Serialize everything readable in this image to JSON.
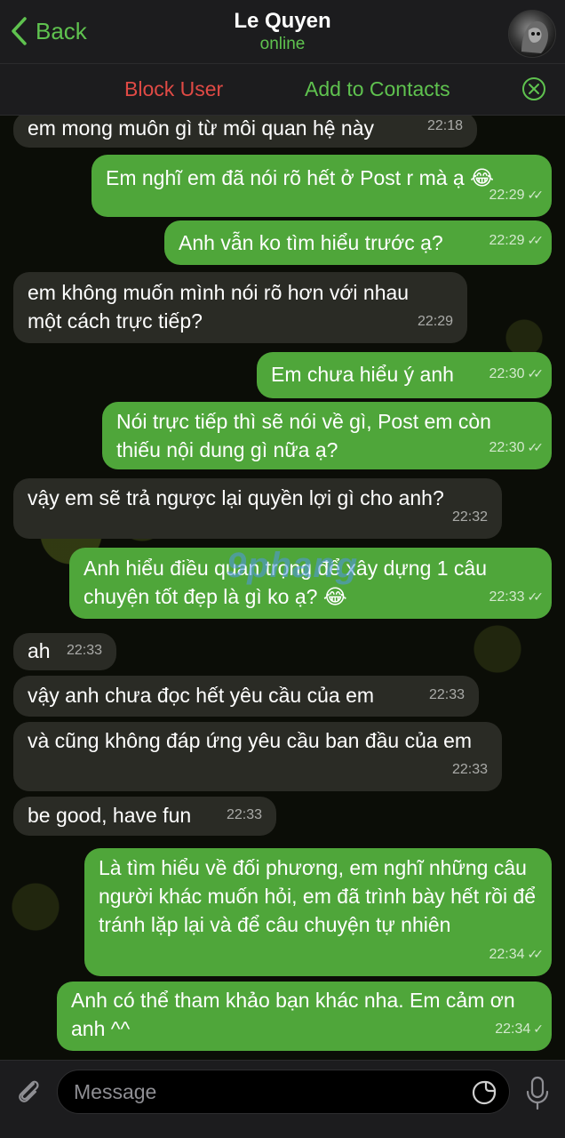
{
  "header": {
    "back_label": "Back",
    "title": "Le Quyen",
    "status": "online"
  },
  "actions": {
    "block": "Block User",
    "add": "Add to Contacts"
  },
  "messages": [
    {
      "dir": "in",
      "text": "em mong muôn gì từ môi quan hệ này",
      "time": "22:18",
      "read": false
    },
    {
      "dir": "out",
      "text": "Em nghĩ em đã nói rõ hết ở Post r mà ạ 😂",
      "time": "22:29",
      "read": true
    },
    {
      "dir": "out",
      "text": "Anh vẫn ko tìm hiểu trước ạ?",
      "time": "22:29",
      "read": true
    },
    {
      "dir": "in",
      "text": "em không muốn mình nói rõ hơn với nhau một cách trực tiếp?",
      "time": "22:29",
      "read": false
    },
    {
      "dir": "out",
      "text": "Em chưa hiểu ý anh",
      "time": "22:30",
      "read": true
    },
    {
      "dir": "out",
      "text": "Nói trực tiếp thì sẽ nói về gì, Post em còn thiếu nội dung gì nữa ạ?",
      "time": "22:30",
      "read": true
    },
    {
      "dir": "in",
      "text": "vậy em sẽ trả ngược lại quyền lợi gì cho anh?",
      "time": "22:32",
      "read": false
    },
    {
      "dir": "out",
      "text": "Anh hiểu điều quan trọng để xây dựng 1 câu chuyện tốt đẹp là gì ko ạ? 😂",
      "time": "22:33",
      "read": true
    },
    {
      "dir": "in",
      "text": "ah",
      "time": "22:33",
      "read": false
    },
    {
      "dir": "in",
      "text": "vậy anh chưa đọc hết yêu cầu của em",
      "time": "22:33",
      "read": false
    },
    {
      "dir": "in",
      "text": "và cũng không đáp ứng yêu cầu ban đầu của em",
      "time": "22:33",
      "read": false
    },
    {
      "dir": "in",
      "text": "be good, have fun",
      "time": "22:33",
      "read": false
    },
    {
      "dir": "out",
      "text": "Là tìm hiểu về đối phương, em nghĩ những câu người khác muốn hỏi, em đã trình bày hết rồi để tránh lặp lại và để câu chuyện tự nhiên",
      "time": "22:34",
      "read": true
    },
    {
      "dir": "out",
      "text": "Anh có thể tham khảo bạn khác nha. Em cảm ơn anh ^^",
      "time": "22:34",
      "read": false
    }
  ],
  "input": {
    "placeholder": "Message"
  },
  "watermark": "9phang",
  "icons": {
    "back": "chevron-left-icon",
    "close": "close-circle-icon",
    "attach": "paperclip-icon",
    "sticker": "sticker-icon",
    "mic": "microphone-icon"
  },
  "colors": {
    "accent": "#5fc24f",
    "danger": "#e04a45",
    "outgoing_bubble": "#4fa63a",
    "incoming_bubble": "#2a2b25"
  }
}
